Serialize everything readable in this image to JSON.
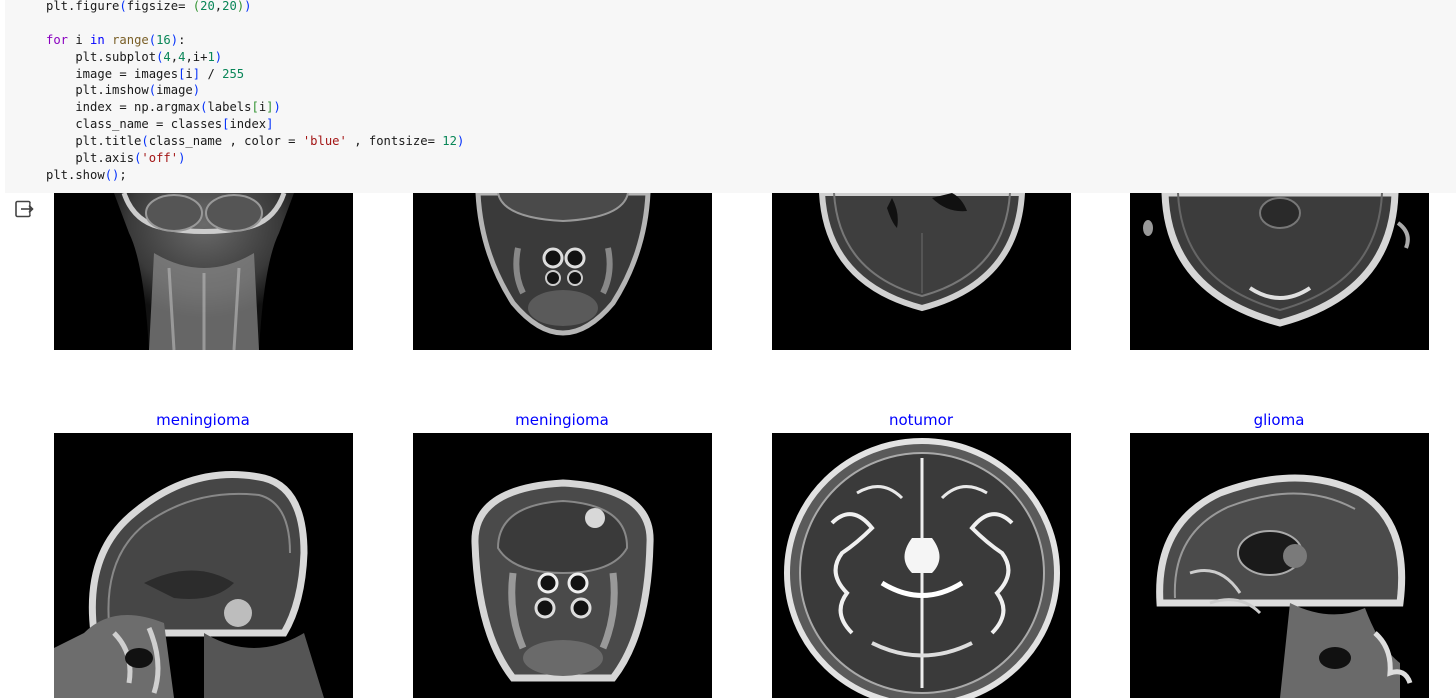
{
  "code_cell": {
    "lines": [
      [
        {
          "t": "plt.figure",
          "c": ""
        },
        {
          "t": "(",
          "c": "paren"
        },
        {
          "t": "figsize= ",
          "c": ""
        },
        {
          "t": "(",
          "c": "bracket"
        },
        {
          "t": "20",
          "c": "num"
        },
        {
          "t": ",",
          "c": ""
        },
        {
          "t": "20",
          "c": "num"
        },
        {
          "t": ")",
          "c": "bracket"
        },
        {
          "t": ")",
          "c": "paren"
        }
      ],
      [],
      [
        {
          "t": "for",
          "c": "kw"
        },
        {
          "t": " i ",
          "c": ""
        },
        {
          "t": "in",
          "c": "kw2"
        },
        {
          "t": " ",
          "c": ""
        },
        {
          "t": "range",
          "c": "builtin"
        },
        {
          "t": "(",
          "c": "paren"
        },
        {
          "t": "16",
          "c": "num"
        },
        {
          "t": ")",
          "c": "paren"
        },
        {
          "t": ":",
          "c": ""
        }
      ],
      [
        {
          "t": "    plt.subplot",
          "c": ""
        },
        {
          "t": "(",
          "c": "paren"
        },
        {
          "t": "4",
          "c": "num"
        },
        {
          "t": ",",
          "c": ""
        },
        {
          "t": "4",
          "c": "num"
        },
        {
          "t": ",i+",
          "c": ""
        },
        {
          "t": "1",
          "c": "num"
        },
        {
          "t": ")",
          "c": "paren"
        }
      ],
      [
        {
          "t": "    image = images",
          "c": ""
        },
        {
          "t": "[",
          "c": "paren"
        },
        {
          "t": "i",
          "c": ""
        },
        {
          "t": "]",
          "c": "paren"
        },
        {
          "t": " / ",
          "c": ""
        },
        {
          "t": "255",
          "c": "num"
        }
      ],
      [
        {
          "t": "    plt.imshow",
          "c": ""
        },
        {
          "t": "(",
          "c": "paren"
        },
        {
          "t": "image",
          "c": ""
        },
        {
          "t": ")",
          "c": "paren"
        }
      ],
      [
        {
          "t": "    index = np.argmax",
          "c": ""
        },
        {
          "t": "(",
          "c": "paren"
        },
        {
          "t": "labels",
          "c": ""
        },
        {
          "t": "[",
          "c": "bracket"
        },
        {
          "t": "i",
          "c": ""
        },
        {
          "t": "]",
          "c": "bracket"
        },
        {
          "t": ")",
          "c": "paren"
        }
      ],
      [
        {
          "t": "    class_name = classes",
          "c": ""
        },
        {
          "t": "[",
          "c": "paren"
        },
        {
          "t": "index",
          "c": ""
        },
        {
          "t": "]",
          "c": "paren"
        }
      ],
      [
        {
          "t": "    plt.title",
          "c": ""
        },
        {
          "t": "(",
          "c": "paren"
        },
        {
          "t": "class_name , color = ",
          "c": ""
        },
        {
          "t": "'blue'",
          "c": "str"
        },
        {
          "t": " , fontsize= ",
          "c": ""
        },
        {
          "t": "12",
          "c": "num"
        },
        {
          "t": ")",
          "c": "paren"
        }
      ],
      [
        {
          "t": "    plt.axis",
          "c": ""
        },
        {
          "t": "(",
          "c": "paren"
        },
        {
          "t": "'off'",
          "c": "str"
        },
        {
          "t": ")",
          "c": "paren"
        }
      ],
      [
        {
          "t": "plt.show",
          "c": ""
        },
        {
          "t": "(",
          "c": "paren"
        },
        {
          "t": ")",
          "c": "paren"
        },
        {
          "t": ";",
          "c": ""
        }
      ]
    ]
  },
  "output": {
    "icon": "output-redirect-icon",
    "top_row": [
      {
        "kind": "coronal-posterior"
      },
      {
        "kind": "coronal-face"
      },
      {
        "kind": "axial-upper"
      },
      {
        "kind": "axial-lower"
      }
    ],
    "bottom_row": [
      {
        "title": "meningioma",
        "kind": "sagittal-lesion"
      },
      {
        "title": "meningioma",
        "kind": "coronal-face-2"
      },
      {
        "title": "notumor",
        "kind": "axial-t2"
      },
      {
        "title": "glioma",
        "kind": "sagittal-cyst"
      }
    ]
  },
  "colors": {
    "title": "#0000ff",
    "code_bg": "#f7f7f7"
  }
}
